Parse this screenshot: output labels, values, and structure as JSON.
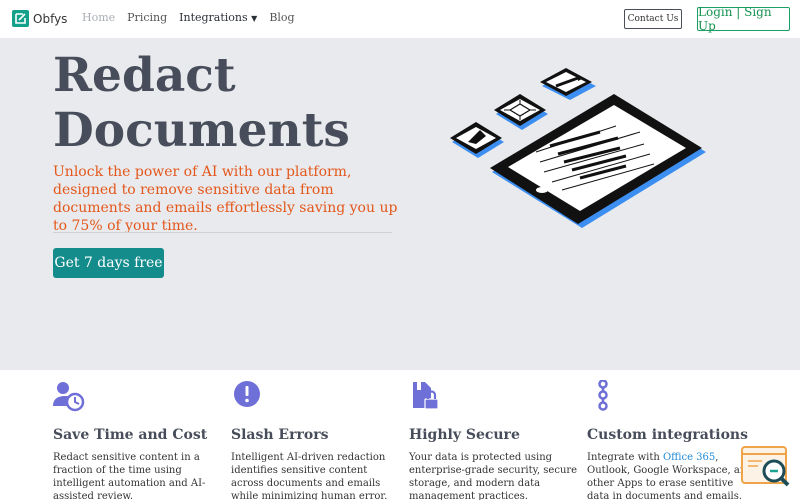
{
  "nav": {
    "logo_text": "Obfys",
    "links": [
      "Home",
      "Pricing",
      "Integrations",
      "Blog"
    ],
    "contact_label": "Contact Us",
    "login_label": "Login | Sign Up"
  },
  "hero": {
    "title_line1": "Redact",
    "title_line2": "Documents",
    "subtitle": "Unlock the power of AI with our platform, designed to remove sensitive data from documents and emails effortlessly saving you up to 75% of your time.",
    "cta_label": "Get 7 days free"
  },
  "features": [
    {
      "icon": "user-clock-icon",
      "title": "Save Time and Cost",
      "text": "Redact sensitive content in a fraction of the time using intelligent automation and AI-assisted review."
    },
    {
      "icon": "exclamation-circle-icon",
      "title": "Slash Errors",
      "text": "Intelligent AI-driven redaction identifies sensitive content across documents and emails while minimizing human error."
    },
    {
      "icon": "file-lock-icon",
      "title": "Highly Secure",
      "text": "Your data is protected using enterprise-grade security, secure storage, and modern data management practices."
    },
    {
      "icon": "link-chain-icon",
      "title": "Custom integrations",
      "text_pre": "Integrate with ",
      "text_link": "Office 365",
      "text_post": ", Outlook, Google Workspace, and other Apps to erase sentitive data in documents and emails."
    }
  ],
  "colors": {
    "accent_teal": "#158c8c",
    "subtitle_orange": "#e4571b",
    "icon_purple": "#6f6fd8",
    "login_green": "#14924f"
  }
}
